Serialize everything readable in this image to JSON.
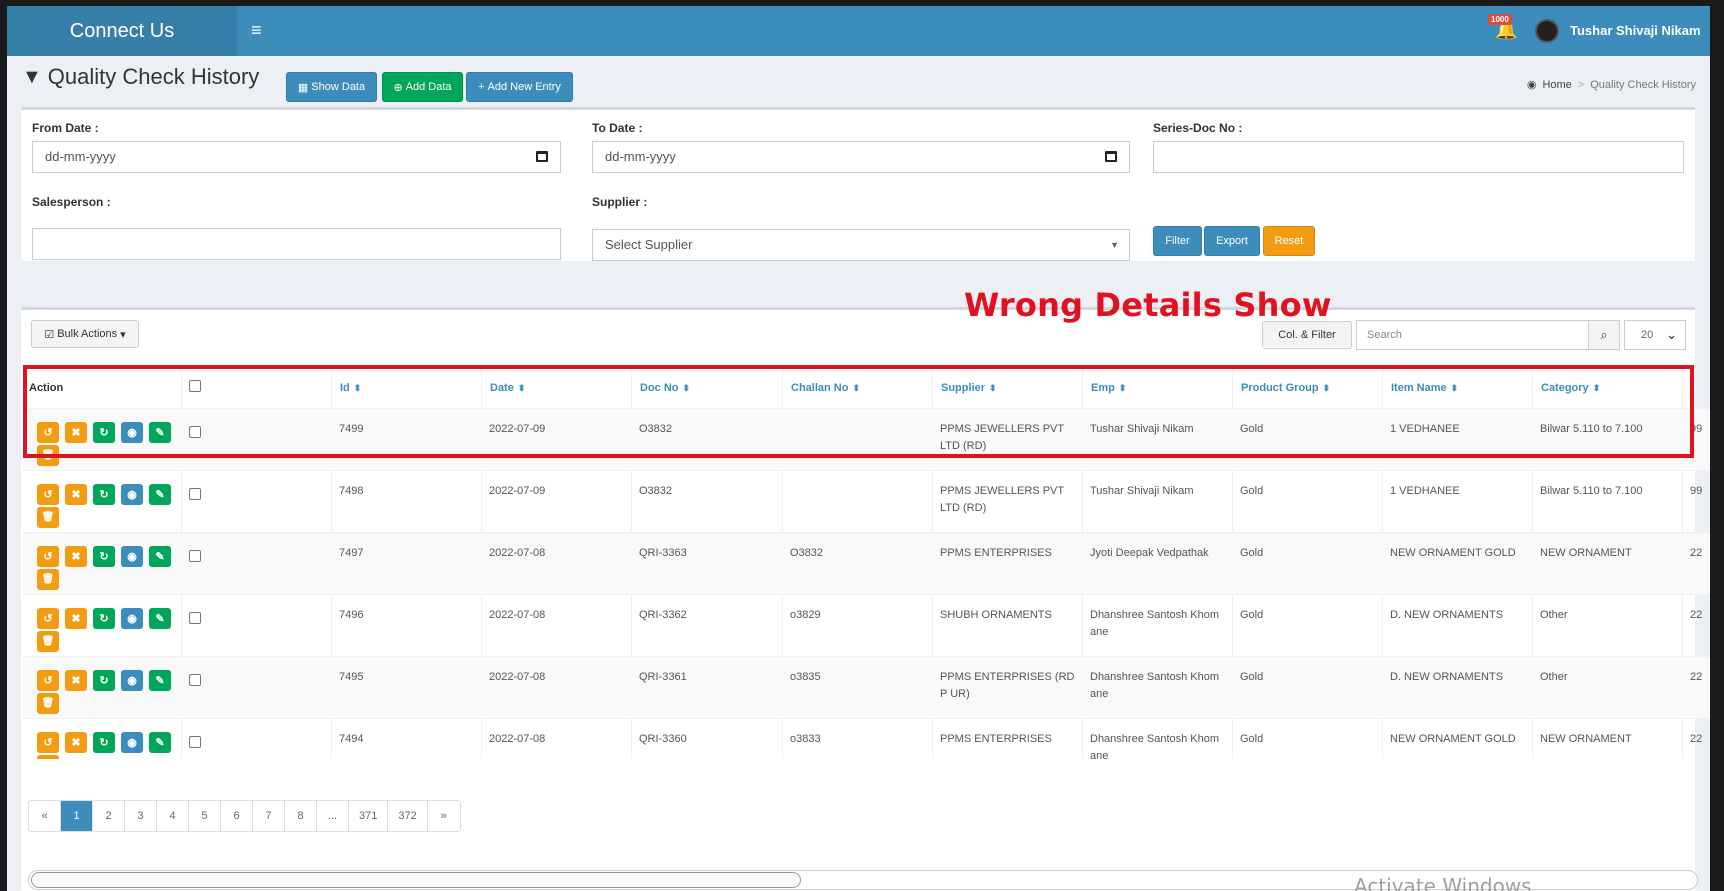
{
  "header": {
    "brand": "Connect Us",
    "hamburger": "≡",
    "notification_count": "1000",
    "user_name": "Tushar Shivaji Nikam"
  },
  "page": {
    "title": "Quality Check History",
    "buttons": {
      "show_data": "Show Data",
      "add_data": "Add Data",
      "add_new_entry": "Add New Entry"
    },
    "breadcrumb": {
      "home": "Home",
      "sep": ">",
      "current": "Quality Check History"
    }
  },
  "filters": {
    "from_date_label": "From Date :",
    "from_date_placeholder": "dd-mm-yyyy",
    "to_date_label": "To Date :",
    "to_date_placeholder": "dd-mm-yyyy",
    "series_label": "Series-Doc No :",
    "salesperson_label": "Salesperson :",
    "supplier_label": "Supplier :",
    "supplier_value": "Select Supplier",
    "filter_btn": "Filter",
    "export_btn": "Export",
    "reset_btn": "Reset"
  },
  "toolbar": {
    "bulk_actions": "Bulk Actions",
    "column_filter": "Col. & Filter",
    "search_placeholder": "Search",
    "per_page": "20"
  },
  "annotation": "Wrong Details Show",
  "table": {
    "headers": [
      "Action",
      "Id",
      "Date",
      "Doc No",
      "Challan No",
      "Supplier",
      "Emp",
      "Product Group",
      "Item Name",
      "Category"
    ],
    "rows": [
      {
        "id": "7499",
        "date": "2022-07-09",
        "doc": "O3832",
        "challan": "",
        "supplier": "PPMS JEWELLERS PVT LTD (RD)",
        "emp": "Tushar Shivaji Nikam",
        "group": "Gold",
        "item": "1 VEDHANEE",
        "category": "Bilwar 5.110 to 7.100",
        "extra": "99"
      },
      {
        "id": "7498",
        "date": "2022-07-09",
        "doc": "O3832",
        "challan": "",
        "supplier": "PPMS JEWELLERS PVT LTD (RD)",
        "emp": "Tushar Shivaji Nikam",
        "group": "Gold",
        "item": "1 VEDHANEE",
        "category": "Bilwar 5.110 to 7.100",
        "extra": "99"
      },
      {
        "id": "7497",
        "date": "2022-07-08",
        "doc": "QRI-3363",
        "challan": "O3832",
        "supplier": "PPMS ENTERPRISES",
        "emp": "Jyoti Deepak Vedpathak",
        "group": "Gold",
        "item": "NEW ORNAMENT GOLD",
        "category": "NEW ORNAMENT",
        "extra": "22"
      },
      {
        "id": "7496",
        "date": "2022-07-08",
        "doc": "QRI-3362",
        "challan": "o3829",
        "supplier": "SHUBH ORNAMENTS",
        "emp": "Dhanshree Santosh Khom ane",
        "group": "Gold",
        "item": "D. NEW ORNAMENTS",
        "category": "Other",
        "extra": "22"
      },
      {
        "id": "7495",
        "date": "2022-07-08",
        "doc": "QRI-3361",
        "challan": "o3835",
        "supplier": "PPMS ENTERPRISES (RD P UR)",
        "emp": "Dhanshree Santosh Khom ane",
        "group": "Gold",
        "item": "D. NEW ORNAMENTS",
        "category": "Other",
        "extra": "22"
      },
      {
        "id": "7494",
        "date": "2022-07-08",
        "doc": "QRI-3360",
        "challan": "o3833",
        "supplier": "PPMS ENTERPRISES",
        "emp": "Dhanshree Santosh Khom ane",
        "group": "Gold",
        "item": "NEW ORNAMENT GOLD",
        "category": "NEW ORNAMENT",
        "extra": "22"
      }
    ]
  },
  "pagination": [
    "«",
    "1",
    "2",
    "3",
    "4",
    "5",
    "6",
    "7",
    "8",
    "...",
    "371",
    "372",
    "»"
  ],
  "watermark": "Activate Windows",
  "colors": {
    "header": "#3c8dbc",
    "brand": "#367fa9",
    "success": "#00a65a",
    "warning": "#f39c12",
    "annotation": "#e0121f"
  }
}
